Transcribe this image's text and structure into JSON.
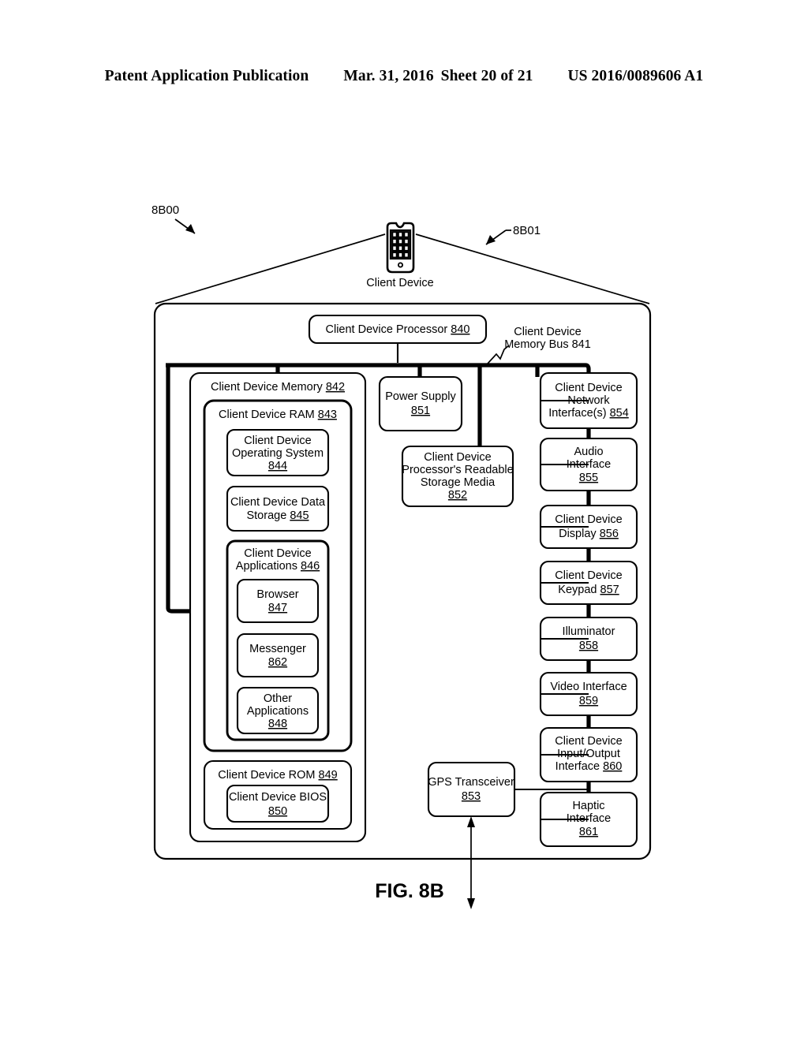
{
  "header": {
    "publication": "Patent Application Publication",
    "date": "Mar. 31, 2016",
    "sheet": "Sheet 20 of 21",
    "patent_number": "US 2016/0089606 A1"
  },
  "figure": {
    "caption": "FIG. 8B",
    "callout_left": "8B00",
    "callout_right": "8B01",
    "device_icon_label": "Client Device",
    "bus_label_line1": "Client Device",
    "bus_label_line2": "Memory Bus 841"
  },
  "blocks": {
    "processor": {
      "line1": "Client Device Processor ",
      "ref": "840"
    },
    "memory": {
      "line1": "Client Device Memory ",
      "ref": "842"
    },
    "ram": {
      "line1": "Client Device RAM ",
      "ref": "843"
    },
    "os": {
      "line1": "Client Device",
      "line2": "Operating System",
      "ref": "844"
    },
    "data_storage": {
      "line1": "Client Device Data",
      "line2": "Storage ",
      "ref": "845"
    },
    "applications": {
      "line1": "Client Device",
      "line2": "Applications ",
      "ref": "846"
    },
    "browser": {
      "line1": "Browser",
      "ref": "847"
    },
    "messenger": {
      "line1": "Messenger",
      "ref": "862"
    },
    "other_applications": {
      "line1": "Other",
      "line2": "Applications",
      "ref": "848"
    },
    "rom": {
      "line1": "Client Device ROM ",
      "ref": "849"
    },
    "bios": {
      "line1": "Client Device BIOS",
      "ref": "850"
    },
    "power_supply": {
      "line1": "Power Supply",
      "ref": "851"
    },
    "storage_media": {
      "line1": "Client Device",
      "line2": "Processor's Readable",
      "line3": "Storage Media",
      "ref": "852"
    },
    "gps": {
      "line1": "GPS Transceiver",
      "ref": "853"
    },
    "network_interface": {
      "line1": "Client Device",
      "line2": "Network",
      "line3": "Interface(s) ",
      "ref": "854"
    },
    "audio_interface": {
      "line1": "Audio",
      "line2": "Interface",
      "ref": "855"
    },
    "display": {
      "line1": "Client Device",
      "line2": "Display ",
      "ref": "856"
    },
    "keypad": {
      "line1": "Client Device",
      "line2": "Keypad ",
      "ref": "857"
    },
    "illuminator": {
      "line1": "Illuminator",
      "ref": "858"
    },
    "video_interface": {
      "line1": "Video Interface",
      "ref": "859"
    },
    "io_interface": {
      "line1": "Client Device",
      "line2": "Input/Output",
      "line3": "Interface ",
      "ref": "860"
    },
    "haptic_interface": {
      "line1": "Haptic",
      "line2": "Interface",
      "ref": "861"
    }
  }
}
